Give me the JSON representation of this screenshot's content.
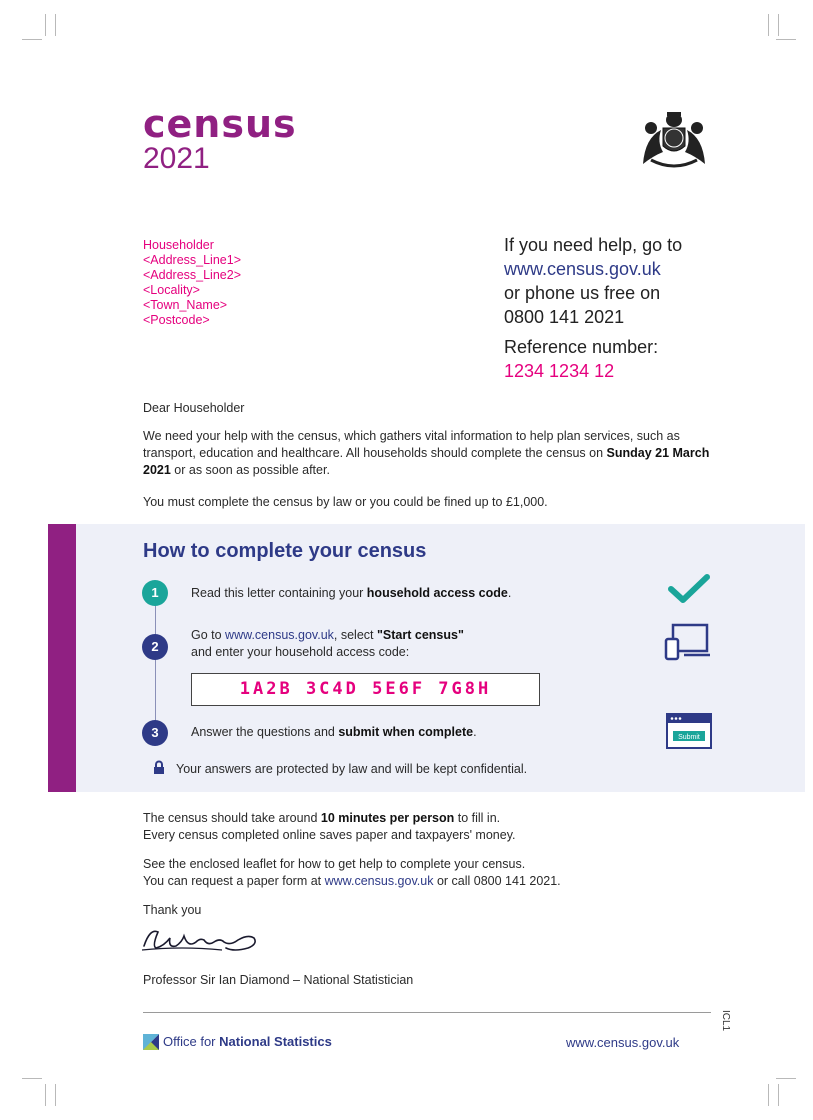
{
  "logo": {
    "word": "census",
    "year": "2021"
  },
  "address": {
    "lines": [
      "Householder",
      "<Address_Line1>",
      "<Address_Line2>",
      "<Locality>",
      "<Town_Name>",
      "<Postcode>"
    ]
  },
  "help": {
    "line1": "If you need help, go to",
    "url": "www.census.gov.uk",
    "line2": "or phone us free on",
    "phone": "0800 141 2021",
    "ref_label": "Reference number:",
    "ref_number": "1234 1234 12"
  },
  "letter": {
    "greeting": "Dear Householder",
    "para1_a": "We need your help with the census, which gathers vital information to help plan services, such as transport, education and healthcare. All households should complete the census on ",
    "para1_bold": "Sunday 21 March 2021",
    "para1_b": " or as soon as possible after.",
    "para2": "You must complete the census by law or you could be fined up to £1,000."
  },
  "steps_panel": {
    "title": "How to complete your census",
    "step1": {
      "num": "1",
      "text_a": "Read this letter containing your ",
      "text_bold": "household access code",
      "text_b": "."
    },
    "step2": {
      "num": "2",
      "text_a": "Go to ",
      "url": "www.census.gov.uk",
      "text_b": ", select ",
      "text_bold": "\"Start census\"",
      "text_c": "and enter your household access code:"
    },
    "access_code": "1A2B  3C4D  5E6F  7G8H",
    "step3": {
      "num": "3",
      "text_a": "Answer the questions and ",
      "text_bold": "submit when complete",
      "text_b": "."
    },
    "submit_icon_label": "Submit",
    "confidential": "Your answers are protected by law and will be kept confidential."
  },
  "closing": {
    "para1_a": "The census should take around ",
    "para1_bold": "10 minutes per person",
    "para1_b": " to fill in.",
    "para1_c": "Every census completed online saves paper and taxpayers' money.",
    "para2_a": "See the enclosed leaflet for how to get help to complete your census.",
    "para2_b": "You can request a paper form at ",
    "para2_url": "www.census.gov.uk",
    "para2_c": " or call 0800 141 2021.",
    "thanks": "Thank you",
    "signatory": "Professor Sir Ian Diamond – National Statistician"
  },
  "footer": {
    "ons_a": "Office for ",
    "ons_bold": "National Statistics",
    "url": "www.census.gov.uk",
    "side_code": "ICL1"
  },
  "colors": {
    "purple": "#902082",
    "magenta": "#e5007e",
    "navy": "#2e3a87",
    "teal": "#1aa59a",
    "panel_bg": "#eef0f8"
  }
}
